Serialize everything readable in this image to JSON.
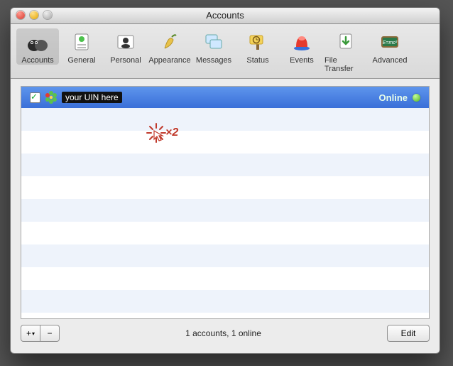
{
  "window": {
    "title": "Accounts"
  },
  "toolbar": {
    "items": [
      {
        "label": "Accounts",
        "name": "tab-accounts",
        "selected": true
      },
      {
        "label": "General",
        "name": "tab-general",
        "selected": false
      },
      {
        "label": "Personal",
        "name": "tab-personal",
        "selected": false
      },
      {
        "label": "Appearance",
        "name": "tab-appearance",
        "selected": false
      },
      {
        "label": "Messages",
        "name": "tab-messages",
        "selected": false
      },
      {
        "label": "Status",
        "name": "tab-status",
        "selected": false
      },
      {
        "label": "Events",
        "name": "tab-events",
        "selected": false
      },
      {
        "label": "File Transfer",
        "name": "tab-file-transfer",
        "selected": false
      },
      {
        "label": "Advanced",
        "name": "tab-advanced",
        "selected": false
      }
    ]
  },
  "account_row": {
    "enabled": true,
    "service": "ICQ",
    "display_name": "your UIN here",
    "status_text": "Online"
  },
  "footer": {
    "add_label": "+",
    "add_menu_indicator": "▾",
    "remove_label": "−",
    "status": "1 accounts, 1 online",
    "edit_label": "Edit"
  },
  "cursor_overlay": {
    "label": "×2"
  }
}
